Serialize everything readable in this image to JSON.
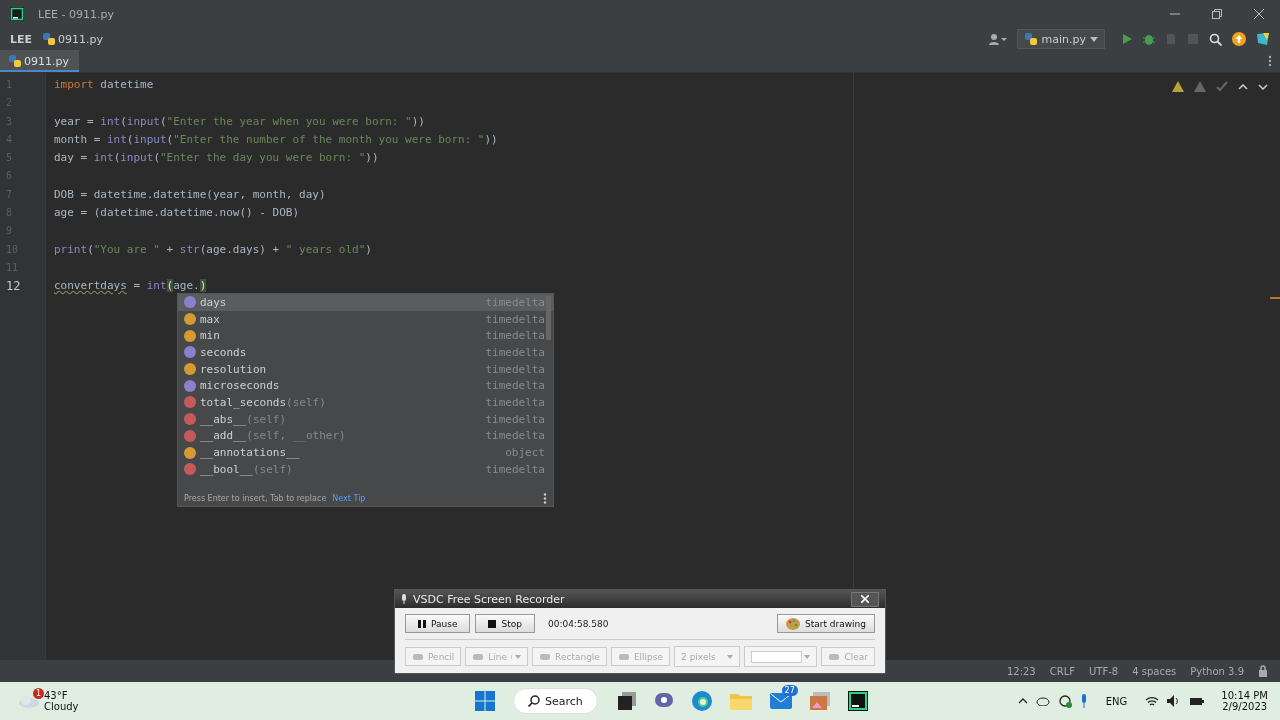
{
  "window": {
    "title": "LEE - 0911.py"
  },
  "breadcrumbs": [
    {
      "label": "LEE",
      "kind": "project"
    },
    {
      "label": "0911.py",
      "kind": "file"
    }
  ],
  "run_config": {
    "label": "main.py"
  },
  "tabs": [
    {
      "label": "0911.py",
      "selected": true
    }
  ],
  "editor": {
    "lines": [
      {
        "number": "1",
        "current": false,
        "tokens": [
          {
            "t": "import",
            "kind": "kw"
          },
          {
            "t": " datetime",
            "kind": "id"
          }
        ]
      },
      {
        "number": "2",
        "current": false
      },
      {
        "number": "3",
        "current": false,
        "tokens": [
          {
            "t": "year = ",
            "kind": "id"
          },
          {
            "t": "int",
            "kind": "bi"
          },
          {
            "t": "(",
            "kind": "id"
          },
          {
            "t": "input",
            "kind": "bi"
          },
          {
            "t": "(",
            "kind": "id"
          },
          {
            "t": "\"Enter the year when you were born: \"",
            "kind": "str"
          },
          {
            "t": "))",
            "kind": "id"
          }
        ]
      },
      {
        "number": "4",
        "current": false,
        "tokens": [
          {
            "t": "month = ",
            "kind": "id"
          },
          {
            "t": "int",
            "kind": "bi"
          },
          {
            "t": "(",
            "kind": "id"
          },
          {
            "t": "input",
            "kind": "bi"
          },
          {
            "t": "(",
            "kind": "id"
          },
          {
            "t": "\"Enter the number of the month you were born: \"",
            "kind": "str"
          },
          {
            "t": "))",
            "kind": "id"
          }
        ]
      },
      {
        "number": "5",
        "current": false,
        "tokens": [
          {
            "t": "day = ",
            "kind": "id"
          },
          {
            "t": "int",
            "kind": "bi"
          },
          {
            "t": "(",
            "kind": "id"
          },
          {
            "t": "input",
            "kind": "bi"
          },
          {
            "t": "(",
            "kind": "id"
          },
          {
            "t": "\"Enter the day you were born: \"",
            "kind": "str"
          },
          {
            "t": "))",
            "kind": "id"
          }
        ]
      },
      {
        "number": "6",
        "current": false
      },
      {
        "number": "7",
        "current": false,
        "tokens": [
          {
            "t": "DOB = datetime.datetime(year, month, day)",
            "kind": "id"
          }
        ]
      },
      {
        "number": "8",
        "current": false,
        "tokens": [
          {
            "t": "age = (datetime.datetime.now() - DOB)",
            "kind": "id"
          }
        ]
      },
      {
        "number": "9",
        "current": false
      },
      {
        "number": "10",
        "current": false,
        "tokens": [
          {
            "t": "print",
            "kind": "bi"
          },
          {
            "t": "(",
            "kind": "id"
          },
          {
            "t": "\"You are \"",
            "kind": "str"
          },
          {
            "t": " + ",
            "kind": "id"
          },
          {
            "t": "str",
            "kind": "bi"
          },
          {
            "t": "(age.days) + ",
            "kind": "id"
          },
          {
            "t": "\" years old\"",
            "kind": "str"
          },
          {
            "t": ")",
            "kind": "id"
          }
        ]
      },
      {
        "number": "11",
        "current": false
      },
      {
        "number": "12",
        "current": true,
        "tokens": [
          {
            "t": "convertdays",
            "kind": "warn"
          },
          {
            "t": " = ",
            "kind": "id"
          },
          {
            "t": "int",
            "kind": "bi"
          },
          {
            "t": "(",
            "kind": "match"
          },
          {
            "t": "age.",
            "kind": "id"
          },
          {
            "t": ")",
            "kind": "match"
          }
        ]
      }
    ]
  },
  "completion": {
    "items": [
      {
        "name": "days",
        "type": "timedelta",
        "kind": "p",
        "selected": true
      },
      {
        "name": "max",
        "type": "timedelta",
        "kind": "f",
        "selected": false
      },
      {
        "name": "min",
        "type": "timedelta",
        "kind": "f",
        "selected": false
      },
      {
        "name": "seconds",
        "type": "timedelta",
        "kind": "p",
        "selected": false
      },
      {
        "name": "resolution",
        "type": "timedelta",
        "kind": "f",
        "selected": false
      },
      {
        "name": "microseconds",
        "type": "timedelta",
        "kind": "p",
        "selected": false
      },
      {
        "name": "total_seconds",
        "params": "(self)",
        "type": "timedelta",
        "kind": "m",
        "selected": false
      },
      {
        "name": "__abs__",
        "params": "(self)",
        "type": "timedelta",
        "kind": "m",
        "selected": false
      },
      {
        "name": "__add__",
        "params": "(self, __other)",
        "type": "timedelta",
        "kind": "m",
        "selected": false
      },
      {
        "name": "__annotations__",
        "type": "object",
        "kind": "f",
        "selected": false
      },
      {
        "name": "__bool__",
        "params": "(self)",
        "type": "timedelta",
        "kind": "m",
        "selected": false
      }
    ],
    "hint": "Press Enter to insert, Tab to replace",
    "hint_link": "Next Tip"
  },
  "recorder": {
    "title": "VSDC Free Screen Recorder",
    "pause": "Pause",
    "stop": "Stop",
    "elapsed": "00:04:58.580",
    "start_drawing": "Start drawing",
    "tools": [
      {
        "label": "Pencil",
        "kind": "button",
        "disabled": true
      },
      {
        "label": "Line",
        "kind": "split",
        "disabled": true
      },
      {
        "label": "Rectangle",
        "kind": "button",
        "disabled": true
      },
      {
        "label": "Ellipse",
        "kind": "button",
        "disabled": true
      },
      {
        "label": "2 pixels",
        "kind": "combo",
        "disabled": true
      },
      {
        "kind": "color",
        "disabled": true
      },
      {
        "label": "Clear",
        "kind": "button",
        "disabled": true
      }
    ]
  },
  "status_bar": [
    "12:23",
    "CRLF",
    "UTF-8",
    "4 spaces",
    "Python 3.9"
  ],
  "taskbar": {
    "weather": {
      "temperature": "43°F",
      "condition": "Cloudy",
      "badge": "1"
    },
    "search": "Search",
    "mail_badge": "27",
    "language": "ENG",
    "time": "10:14 PM",
    "date": "2/9/2023"
  }
}
